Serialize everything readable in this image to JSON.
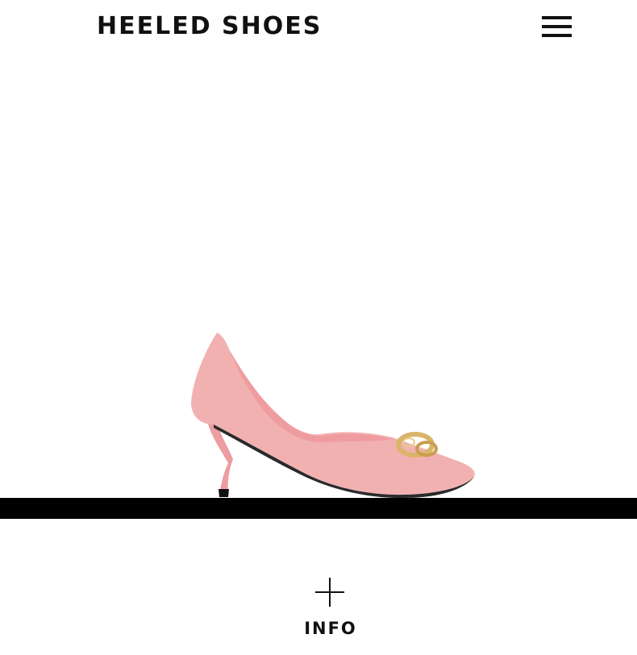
{
  "header": {
    "title": "HEELED SHOES",
    "menu_icon": "hamburger-menu-icon"
  },
  "product": {
    "image_subject": "pink pointed-toe heeled pump with gold buckle",
    "colors": {
      "shoe": "#f2b1b1",
      "lining": "#ef9ca0",
      "buckle": "#d9b46a",
      "heel_tip": "#111111"
    }
  },
  "info_section": {
    "label": "INFO",
    "icon": "plus-icon"
  },
  "colors": {
    "background": "#ffffff",
    "text": "#111111",
    "bar": "#000000"
  }
}
